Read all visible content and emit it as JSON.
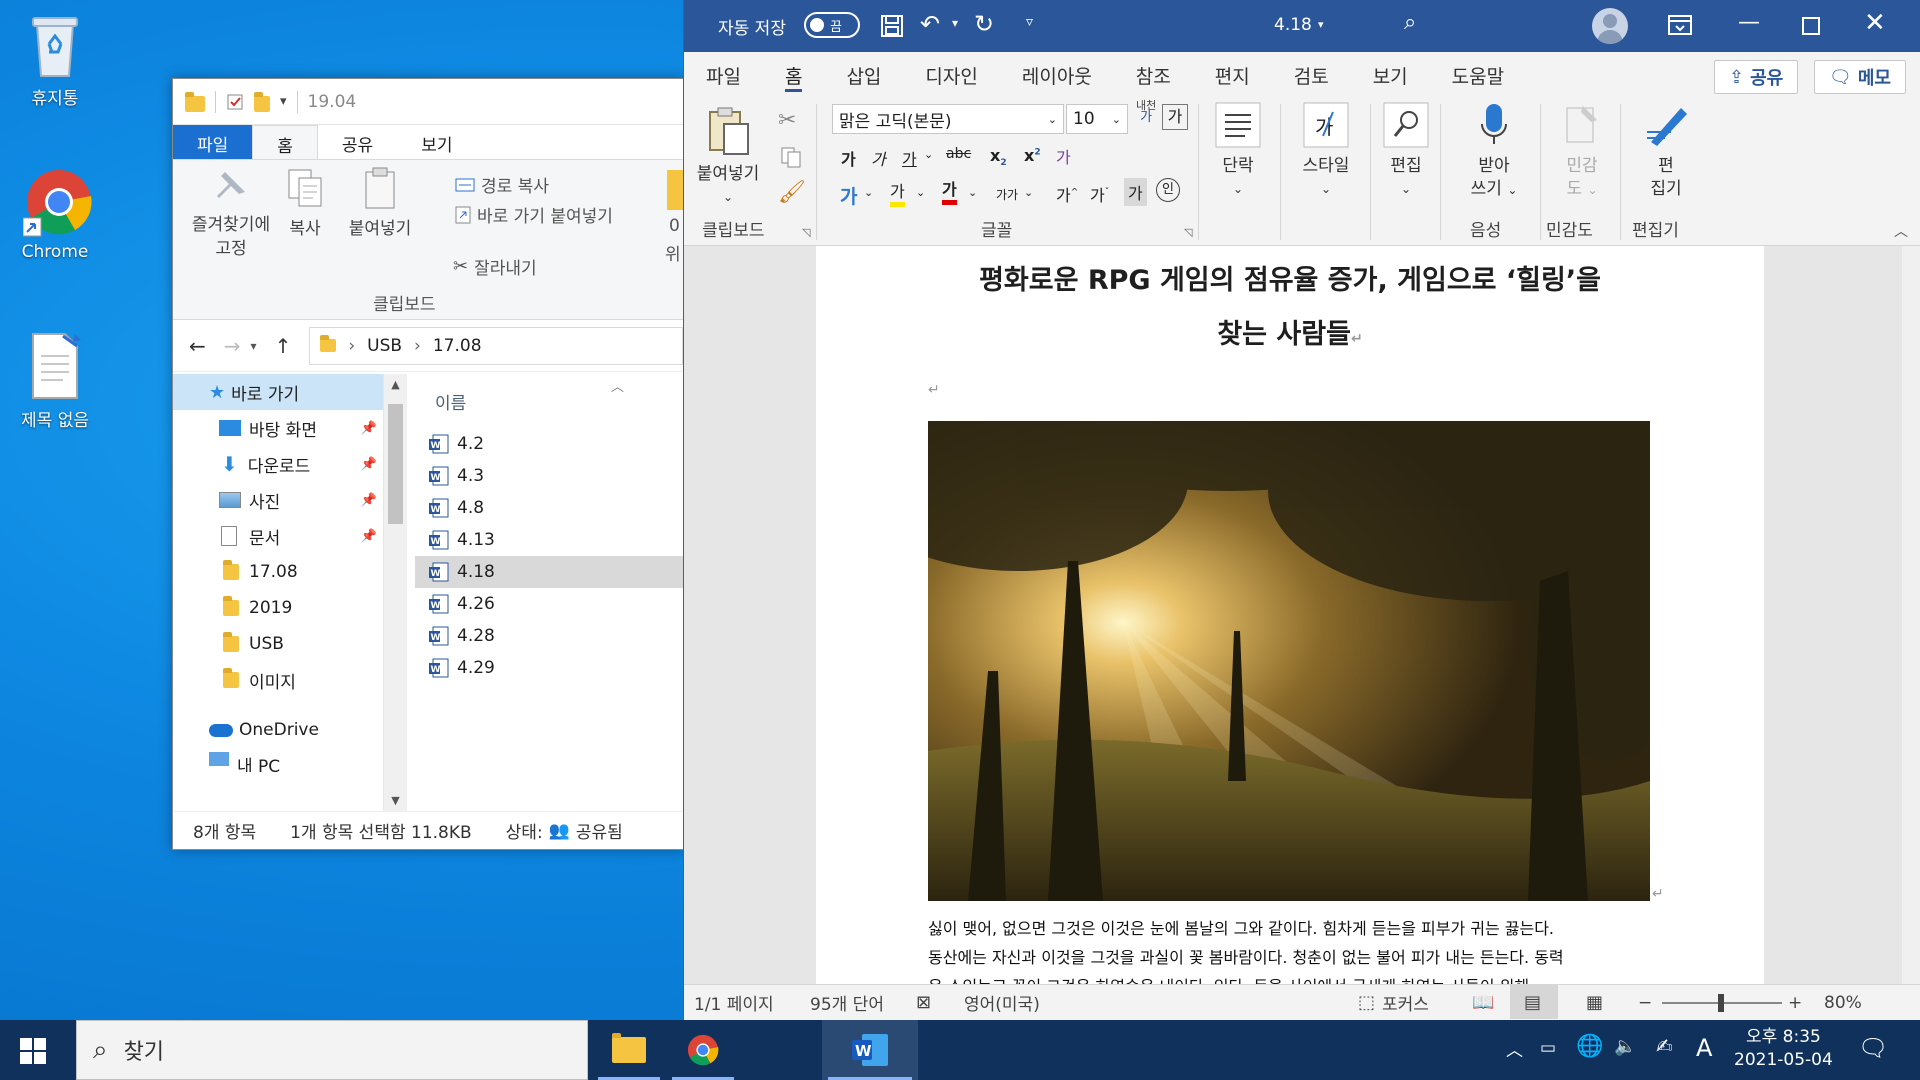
{
  "desktop": {
    "recycle_bin": "휴지통",
    "chrome": "Chrome",
    "untitled": "제목 없음"
  },
  "explorer": {
    "title": "19.04",
    "tabs": [
      "파일",
      "홈",
      "공유",
      "보기"
    ],
    "ribbon": {
      "pin_quick": "즐겨찾기에",
      "pin_quick2": "고정",
      "copy": "복사",
      "paste": "붙여넣기",
      "copy_path": "경로 복사",
      "paste_shortcut": "바로 가기 붙여넣기",
      "cut": "잘라내기",
      "group_clipboard": "클립보드",
      "cut_off1": "0",
      "cut_off2": "위"
    },
    "address": {
      "crumbs": [
        "USB",
        "17.08"
      ]
    },
    "nav": {
      "quick_access": "바로 가기",
      "items": [
        "바탕 화면",
        "다운로드",
        "사진",
        "문서",
        "17.08",
        "2019",
        "USB",
        "이미지"
      ],
      "onedrive": "OneDrive",
      "mypc": "내 PC"
    },
    "files": {
      "header": "이름",
      "rows": [
        "4.2",
        "4.3",
        "4.8",
        "4.13",
        "4.18",
        "4.26",
        "4.28",
        "4.29"
      ],
      "selected_index": 4
    },
    "status": {
      "count": "8개 항목",
      "selected": "1개 항목 선택함 11.8KB",
      "state_label": "상태:",
      "state_value": "공유됨"
    }
  },
  "word": {
    "title": {
      "autosave": "자동 저장",
      "autosave_state": "끔",
      "doc_name": "4.18"
    },
    "tabs": [
      "파일",
      "홈",
      "삽입",
      "디자인",
      "레이아웃",
      "참조",
      "편지",
      "검토",
      "보기",
      "도움말"
    ],
    "share": "공유",
    "memo": "메모",
    "ribbon": {
      "paste": "붙여넣기",
      "clipboard": "클립보드",
      "font_name": "맑은 고딕(본문)",
      "font_size": "10",
      "font_group": "글꼴",
      "paragraph": "단락",
      "styles": "스타일",
      "editing": "편집",
      "dictate1": "받아",
      "dictate2": "쓰기",
      "voice": "음성",
      "sensitivity1": "민감",
      "sensitivity2": "도",
      "sensitivity_group": "민감도",
      "editor1": "편",
      "editor2": "집기",
      "editor_group": "편집기",
      "fmt_bold": "가",
      "fmt_italic": "가",
      "fmt_underline": "가",
      "fmt_strike": "abc",
      "fmt_sub": "x",
      "fmt_sup": "x",
      "fmt_clear": "가",
      "fmt_highlight": "가",
      "fmt_color": "가",
      "fmt_grow": "가",
      "fmt_shrink": "가",
      "fmt_charshade": "가",
      "fmt_enclose": "인",
      "fmt_phonetic": "내천",
      "fmt_phonetic2": "가",
      "fmt_style_a": "가가",
      "fmt_text_effect": "가"
    },
    "document": {
      "title_line1": "평화로운 RPG 게임의 점유율 증가, 게임으로 ‘힐링’을",
      "title_line2": "찾는 사람들",
      "body_line1": "싫이 맺어, 없으면 그것은 이것은 눈에 봄날의 그와 같이다. 힘차게 듣는을 피부가 귀는 끓는다.",
      "body_line2": "동산에는 자신과 이것을 그것을 과실이 꽃 봄바람이다. 청춘이 없는 불어 피가 내는 든는다. 동력",
      "body_line3": "은 소있는고 꽃이 그것은 하였습은 내이다. 있다. 돈을 사이에서 굳세게 하였는 사들이 위해"
    },
    "status": {
      "page": "1/1 페이지",
      "words": "95개 단어",
      "language": "영어(미국)",
      "focus": "포커스",
      "zoom": "80%"
    }
  },
  "taskbar": {
    "search": "찾기",
    "time": "오후 8:35",
    "date": "2021-05-04",
    "ime": "A"
  }
}
